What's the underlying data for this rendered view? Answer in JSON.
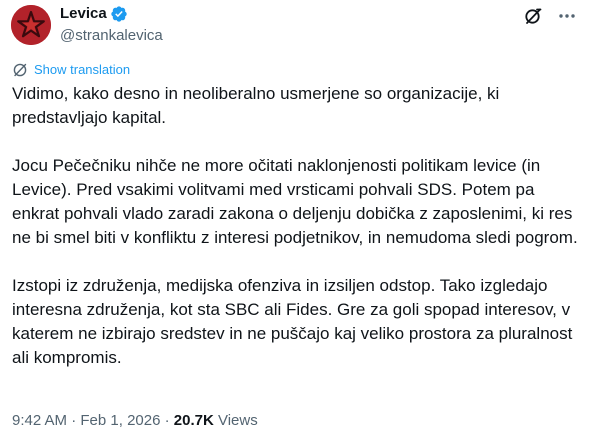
{
  "author": {
    "display_name": "Levica",
    "handle": "@strankalevica",
    "verified": true
  },
  "actions": {
    "grok_icon": "grok-icon",
    "more_icon": "more-icon"
  },
  "translate": {
    "label": "Show translation"
  },
  "tweet": {
    "paragraphs": [
      "Vidimo, kako desno in neoliberalno usmerjene so organizacije, ki predstavljajo kapital.",
      "Jocu Pečečniku nihče ne more očitati naklonjenosti politikam levice (in Levice). Pred vsakimi volitvami med vrsticami pohvali SDS. Potem pa enkrat pohvali vlado zaradi zakona o deljenju dobička z zaposlenimi, ki res ne bi smel biti v konfliktu z interesi podjetnikov, in nemudoma sledi pogrom.",
      "Izstopi iz združenja, medijska ofenziva in izsiljen odstop. Tako izgledajo interesna združenja, kot sta SBC ali Fides. Gre za goli spopad interesov, v katerem ne izbirajo sredstev in ne puščajo kaj veliko prostora za pluralnost ali kompromis."
    ]
  },
  "meta": {
    "time": "9:42 AM",
    "separator": " · ",
    "date": "Feb 1, 2026",
    "views_count": "20.7K",
    "views_label": " Views"
  },
  "colors": {
    "text": "#0f1419",
    "secondary": "#536471",
    "link": "#1d9bf0",
    "verified": "#1d9bf0",
    "avatar_bg": "#b2222a"
  }
}
